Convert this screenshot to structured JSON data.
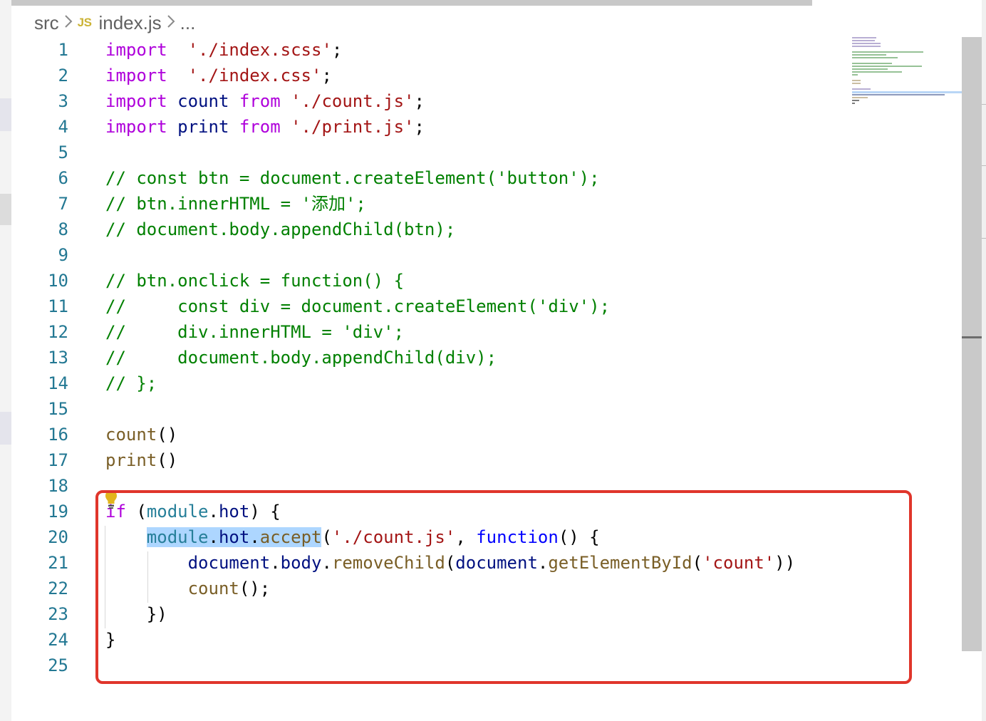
{
  "breadcrumb": {
    "folder": "src",
    "file_icon": "JS",
    "file": "index.js",
    "more": "..."
  },
  "lines": [
    {
      "n": "1",
      "t": [
        [
          "kw",
          "import"
        ],
        [
          "",
          "  "
        ],
        [
          "str",
          "'./index.scss'"
        ],
        [
          "",
          ";"
        ]
      ]
    },
    {
      "n": "2",
      "t": [
        [
          "kw",
          "import"
        ],
        [
          "",
          "  "
        ],
        [
          "str",
          "'./index.css'"
        ],
        [
          "",
          ";"
        ]
      ]
    },
    {
      "n": "3",
      "t": [
        [
          "kw",
          "import"
        ],
        [
          "",
          " "
        ],
        [
          "var",
          "count"
        ],
        [
          "",
          " "
        ],
        [
          "kw",
          "from"
        ],
        [
          "",
          " "
        ],
        [
          "str",
          "'./count.js'"
        ],
        [
          "",
          ";"
        ]
      ]
    },
    {
      "n": "4",
      "t": [
        [
          "kw",
          "import"
        ],
        [
          "",
          " "
        ],
        [
          "var",
          "print"
        ],
        [
          "",
          " "
        ],
        [
          "kw",
          "from"
        ],
        [
          "",
          " "
        ],
        [
          "str",
          "'./print.js'"
        ],
        [
          "",
          ";"
        ]
      ]
    },
    {
      "n": "5",
      "t": []
    },
    {
      "n": "6",
      "t": [
        [
          "cmt",
          "// const btn = document.createElement('button');"
        ]
      ]
    },
    {
      "n": "7",
      "t": [
        [
          "cmt",
          "// btn.innerHTML = '添加';"
        ]
      ]
    },
    {
      "n": "8",
      "t": [
        [
          "cmt",
          "// document.body.appendChild(btn);"
        ]
      ]
    },
    {
      "n": "9",
      "t": []
    },
    {
      "n": "10",
      "t": [
        [
          "cmt",
          "// btn.onclick = function() {"
        ]
      ]
    },
    {
      "n": "11",
      "t": [
        [
          "cmt",
          "//     const div = document.createElement('div');"
        ]
      ]
    },
    {
      "n": "12",
      "t": [
        [
          "cmt",
          "//     div.innerHTML = 'div';"
        ]
      ]
    },
    {
      "n": "13",
      "t": [
        [
          "cmt",
          "//     document.body.appendChild(div);"
        ]
      ]
    },
    {
      "n": "14",
      "t": [
        [
          "cmt",
          "// };"
        ]
      ]
    },
    {
      "n": "15",
      "t": []
    },
    {
      "n": "16",
      "t": [
        [
          "fn",
          "count"
        ],
        [
          "",
          "()"
        ]
      ]
    },
    {
      "n": "17",
      "t": [
        [
          "fn",
          "print"
        ],
        [
          "",
          "()"
        ]
      ]
    },
    {
      "n": "18",
      "t": []
    },
    {
      "n": "19",
      "t": [
        [
          "kw",
          "if"
        ],
        [
          "",
          " ("
        ],
        [
          "mod",
          "module"
        ],
        [
          "",
          "."
        ],
        [
          "var",
          "hot"
        ],
        [
          "",
          ") {"
        ]
      ]
    },
    {
      "n": "20",
      "t": [
        [
          "",
          "    "
        ],
        [
          "mod sel",
          "module"
        ],
        [
          "sel",
          "."
        ],
        [
          "var sel",
          "hot"
        ],
        [
          "sel",
          "."
        ],
        [
          "fn sel",
          "accept"
        ],
        [
          "",
          "("
        ],
        [
          "str",
          "'./count.js'"
        ],
        [
          "",
          ", "
        ],
        [
          "kwb",
          "function"
        ],
        [
          "",
          "() {"
        ]
      ]
    },
    {
      "n": "21",
      "t": [
        [
          "",
          "        "
        ],
        [
          "var",
          "document"
        ],
        [
          "",
          "."
        ],
        [
          "var",
          "body"
        ],
        [
          "",
          "."
        ],
        [
          "fn",
          "removeChild"
        ],
        [
          "",
          "("
        ],
        [
          "var",
          "document"
        ],
        [
          "",
          "."
        ],
        [
          "fn",
          "getElementById"
        ],
        [
          "",
          "("
        ],
        [
          "str",
          "'count'"
        ],
        [
          "",
          "))"
        ]
      ]
    },
    {
      "n": "22",
      "t": [
        [
          "",
          "        "
        ],
        [
          "fn",
          "count"
        ],
        [
          "",
          "();"
        ]
      ]
    },
    {
      "n": "23",
      "t": [
        [
          "",
          "    })"
        ]
      ]
    },
    {
      "n": "24",
      "t": [
        [
          "",
          "}"
        ]
      ]
    },
    {
      "n": "25",
      "t": []
    }
  ],
  "colors": {
    "keyword": "#af00db",
    "string": "#a31515",
    "comment": "#008000",
    "function": "#795e26",
    "variable": "#001080",
    "highlight_border": "#e0352b"
  },
  "icons": {
    "lightbulb": "lightbulb-icon",
    "chevron": "chevron-right-icon"
  }
}
